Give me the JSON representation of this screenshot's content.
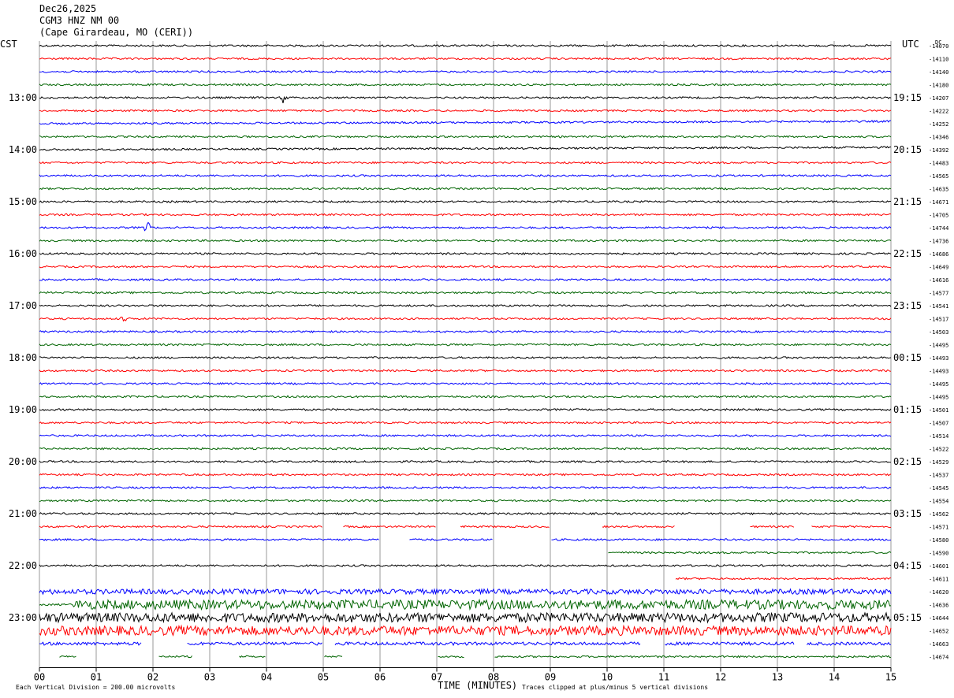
{
  "header": {
    "date": "Dec26,2025",
    "station": "CGM3 HNZ NM 00",
    "location": "(Cape Girardeau, MO (CERI))"
  },
  "left_tz": "CST",
  "right_tz": "UTC",
  "dc_label": "DC",
  "footer": {
    "scale_note": "Each Vertical Division =  200.00 microvolts",
    "xlabel": "TIME (MINUTES)",
    "clip_note": "Traces clipped at plus/minus 5 vertical divisions"
  },
  "chart_data": {
    "type": "line",
    "title": "CGM3 HNZ NM 00",
    "xlabel": "TIME (MINUTES)",
    "xlim": [
      0,
      15
    ],
    "x_ticks": [
      "00",
      "01",
      "02",
      "03",
      "04",
      "05",
      "06",
      "07",
      "08",
      "09",
      "10",
      "11",
      "12",
      "13",
      "14",
      "15"
    ],
    "trace_colors": [
      "#000000",
      "#ff0000",
      "#0000ff",
      "#006400"
    ],
    "left_hour_labels": [
      "13:00",
      "14:00",
      "15:00",
      "16:00",
      "17:00",
      "18:00",
      "19:00",
      "20:00",
      "21:00",
      "22:00",
      "23:00"
    ],
    "right_hour_labels": [
      "19:15",
      "20:15",
      "21:15",
      "22:15",
      "23:15",
      "00:15",
      "01:15",
      "02:15",
      "03:15",
      "04:15",
      "05:15"
    ],
    "dc_offsets": [
      "-14070",
      "-14110",
      "-14140",
      "-14180",
      "-14207",
      "-14222",
      "-14252",
      "-14346",
      "-14392",
      "-14483",
      "-14565",
      "-14635",
      "-14671",
      "-14705",
      "-14744",
      "-14736",
      "-14686",
      "-14649",
      "-14616",
      "-14577",
      "-14541",
      "-14517",
      "-14503",
      "-14495",
      "-14493",
      "-14493",
      "-14495",
      "-14495",
      "-14501",
      "-14507",
      "-14514",
      "-14522",
      "-14529",
      "-14537",
      "-14545",
      "-14554",
      "-14562",
      "-14571",
      "-14580",
      "-14590",
      "-14601",
      "-14611",
      "-14620",
      "-14636",
      "-14644",
      "-14652",
      "-14663",
      "-14674"
    ],
    "events": [
      {
        "trace": 4,
        "minute": 4.3,
        "note": "spike"
      },
      {
        "trace": 14,
        "minute": 1.9,
        "note": "burst"
      },
      {
        "trace": 21,
        "minute": 1.5,
        "note": "burst"
      }
    ]
  }
}
